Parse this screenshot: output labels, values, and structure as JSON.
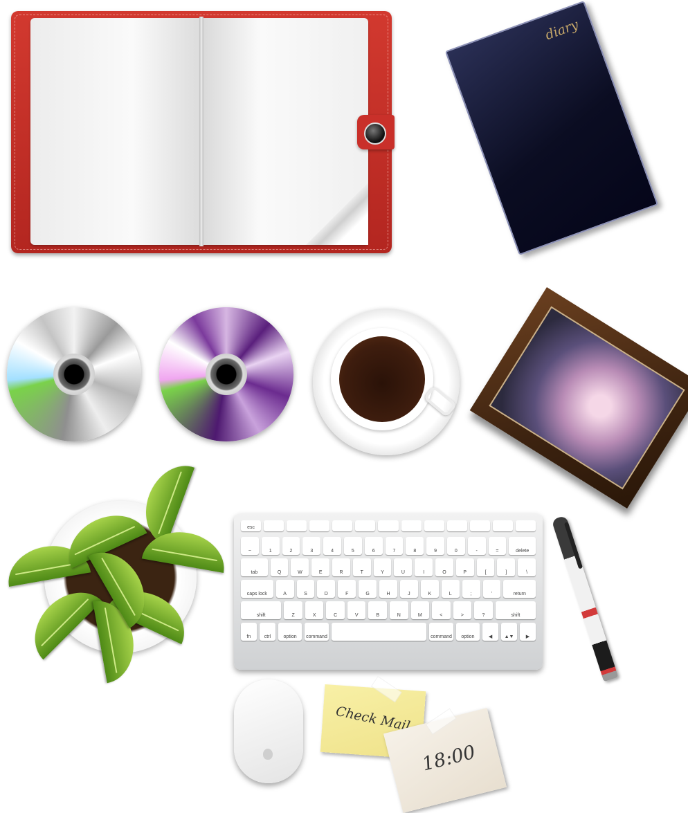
{
  "diary": {
    "title": "diary"
  },
  "notes": {
    "yellow": "Check Mail",
    "white": "18:00"
  },
  "keyboard": {
    "fn_row": [
      "esc",
      "",
      "",
      "",
      "",
      "",
      "",
      "",
      "",
      "",
      "",
      "",
      ""
    ],
    "rows": [
      [
        "~",
        "1",
        "2",
        "3",
        "4",
        "5",
        "6",
        "7",
        "8",
        "9",
        "0",
        "-",
        "=",
        "delete"
      ],
      [
        "tab",
        "Q",
        "W",
        "E",
        "R",
        "T",
        "Y",
        "U",
        "I",
        "O",
        "P",
        "[",
        "]",
        "\\"
      ],
      [
        "caps lock",
        "A",
        "S",
        "D",
        "F",
        "G",
        "H",
        "J",
        "K",
        "L",
        ";",
        "'",
        "return"
      ],
      [
        "shift",
        "Z",
        "X",
        "C",
        "V",
        "B",
        "N",
        "M",
        "<",
        ">",
        "?",
        "shift"
      ],
      [
        "fn",
        "ctrl",
        "option",
        "command",
        "",
        "command",
        "option",
        "◀",
        "▲▼",
        "▶"
      ]
    ]
  },
  "colors": {
    "notebook": "#c9302a",
    "diary": "#0b0d22",
    "disc_purple": "#5a1f7c",
    "coffee": "#3e1d0e",
    "plant": "#6aa524",
    "note_yellow": "#f3e892"
  }
}
